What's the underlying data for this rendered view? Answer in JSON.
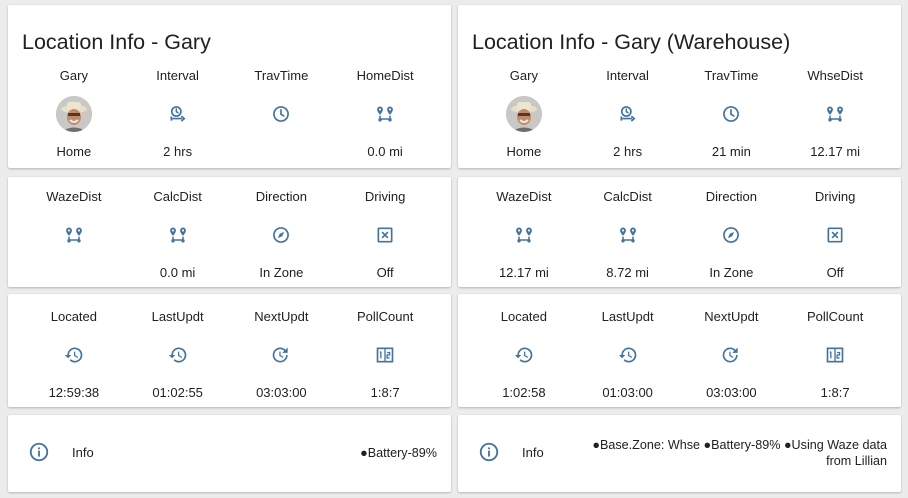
{
  "colors": {
    "icon": "#44739e",
    "card": "#ffffff",
    "background": "#ececec",
    "text": "#212121"
  },
  "left": {
    "title": "Location Info - Gary",
    "row1": [
      {
        "name": "Gary",
        "icon": "avatar",
        "state": "Home"
      },
      {
        "name": "Interval",
        "icon": "timer-sand-arrow-icon",
        "state": "2 hrs"
      },
      {
        "name": "TravTime",
        "icon": "clock-icon",
        "state": ""
      },
      {
        "name": "HomeDist",
        "icon": "map-marker-distance-icon",
        "state": "0.0 mi"
      }
    ],
    "row2": [
      {
        "name": "WazeDist",
        "icon": "map-marker-distance-icon",
        "state": ""
      },
      {
        "name": "CalcDist",
        "icon": "map-marker-distance-icon",
        "state": "0.0 mi"
      },
      {
        "name": "Direction",
        "icon": "compass-icon",
        "state": "In Zone"
      },
      {
        "name": "Driving",
        "icon": "close-box-icon",
        "state": "Off"
      }
    ],
    "row3": [
      {
        "name": "Located",
        "icon": "history-icon",
        "state": "12:59:38"
      },
      {
        "name": "LastUpdt",
        "icon": "history-icon",
        "state": "01:02:55"
      },
      {
        "name": "NextUpdt",
        "icon": "update-icon",
        "state": "03:03:00"
      },
      {
        "name": "PollCount",
        "icon": "counter-icon",
        "state": "1:8:7"
      }
    ],
    "info": {
      "label": "Info",
      "value": "●Battery-89%"
    }
  },
  "right": {
    "title": "Location Info - Gary (Warehouse)",
    "row1": [
      {
        "name": "Gary",
        "icon": "avatar",
        "state": "Home"
      },
      {
        "name": "Interval",
        "icon": "timer-sand-arrow-icon",
        "state": "2 hrs"
      },
      {
        "name": "TravTime",
        "icon": "clock-icon",
        "state": "21 min"
      },
      {
        "name": "WhseDist",
        "icon": "map-marker-distance-icon",
        "state": "12.17 mi"
      }
    ],
    "row2": [
      {
        "name": "WazeDist",
        "icon": "map-marker-distance-icon",
        "state": "12.17 mi"
      },
      {
        "name": "CalcDist",
        "icon": "map-marker-distance-icon",
        "state": "8.72 mi"
      },
      {
        "name": "Direction",
        "icon": "compass-icon",
        "state": "In Zone"
      },
      {
        "name": "Driving",
        "icon": "close-box-icon",
        "state": "Off"
      }
    ],
    "row3": [
      {
        "name": "Located",
        "icon": "history-icon",
        "state": "1:02:58"
      },
      {
        "name": "LastUpdt",
        "icon": "history-icon",
        "state": "01:03:00"
      },
      {
        "name": "NextUpdt",
        "icon": "update-icon",
        "state": "03:03:00"
      },
      {
        "name": "PollCount",
        "icon": "counter-icon",
        "state": "1:8:7"
      }
    ],
    "info": {
      "label": "Info",
      "value": "●Base.Zone: Whse ●Battery-89% ●Using Waze data from Lillian"
    }
  }
}
